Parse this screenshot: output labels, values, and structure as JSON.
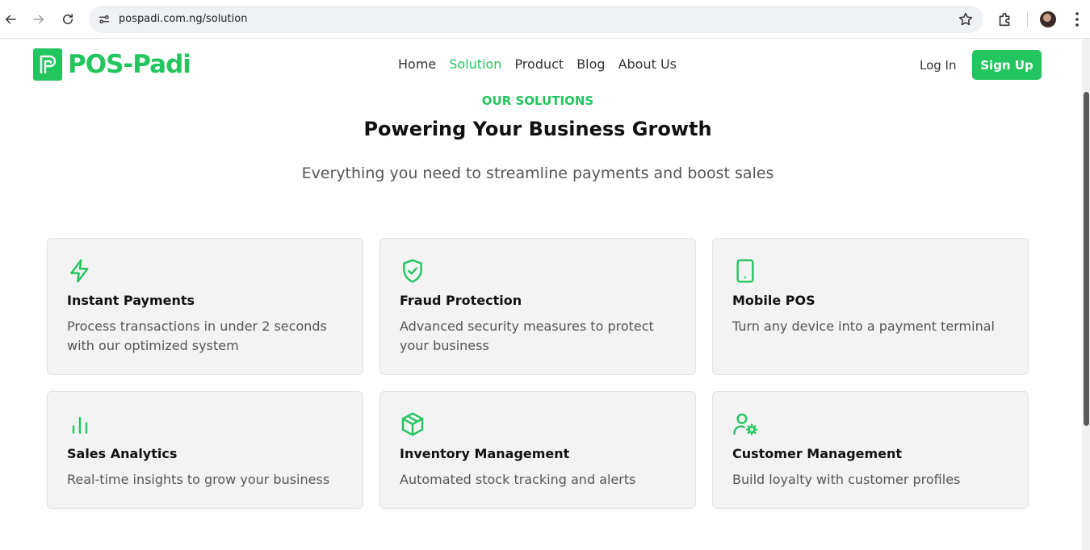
{
  "browser": {
    "url": "pospadi.com.ng/solution",
    "icons": [
      "back-arrow-icon",
      "forward-arrow-icon",
      "reload-icon",
      "site-info-icon",
      "bookmark-star-icon",
      "extensions-icon",
      "profile-avatar",
      "kebab-menu-icon"
    ]
  },
  "site": {
    "logo_text": "POS-Padi",
    "nav": [
      {
        "label": "Home",
        "active": false
      },
      {
        "label": "Solution",
        "active": true
      },
      {
        "label": "Product",
        "active": false
      },
      {
        "label": "Blog",
        "active": false
      },
      {
        "label": "About Us",
        "active": false
      }
    ],
    "login_label": "Log In",
    "signup_label": "Sign Up",
    "accent_color": "#22c55e"
  },
  "hero": {
    "eyebrow": "OUR SOLUTIONS",
    "title": "Powering Your Business Growth",
    "subtitle": "Everything you need to streamline payments and boost sales"
  },
  "cards": [
    {
      "icon": "lightning-icon",
      "title": "Instant Payments",
      "desc": "Process transactions in under 2 seconds with our optimized system"
    },
    {
      "icon": "shield-check-icon",
      "title": "Fraud Protection",
      "desc": "Advanced security measures to protect your business"
    },
    {
      "icon": "smartphone-icon",
      "title": "Mobile POS",
      "desc": "Turn any device into a payment terminal"
    },
    {
      "icon": "bar-chart-icon",
      "title": "Sales Analytics",
      "desc": "Real-time insights to grow your business"
    },
    {
      "icon": "package-icon",
      "title": "Inventory Management",
      "desc": "Automated stock tracking and alerts"
    },
    {
      "icon": "user-cog-icon",
      "title": "Customer Management",
      "desc": "Build loyalty with customer profiles"
    }
  ]
}
